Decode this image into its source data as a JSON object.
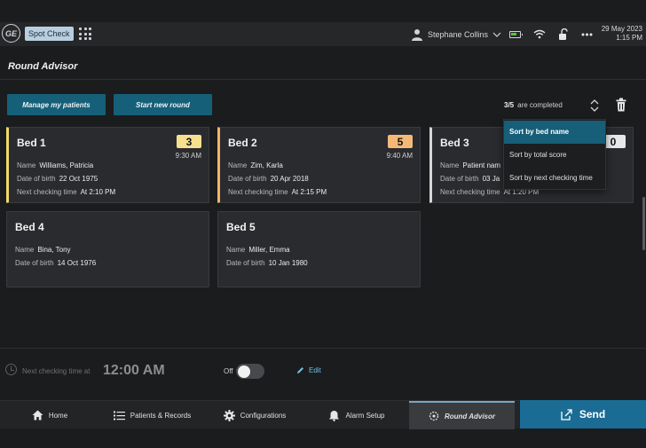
{
  "topbar": {
    "logo_text": "GE",
    "mode_label": "Spot Check",
    "user_name": "Stephane Collins",
    "date": "29 May 2023",
    "time": "1:15 PM"
  },
  "page": {
    "title": "Round Advisor"
  },
  "toolbar": {
    "manage_label": "Manage my patients",
    "start_label": "Start new round",
    "completed_count": "3/5",
    "completed_text": "are completed"
  },
  "sort_menu": {
    "items": [
      "Sort by bed name",
      "Sort by total score",
      "Sort by next checking time"
    ],
    "selected": "Sort by bed name"
  },
  "labels": {
    "name": "Name",
    "dob": "Date of birth",
    "next": "Next checking time"
  },
  "beds": [
    {
      "bed": "Bed 1",
      "score": "3",
      "time": "9:30 AM",
      "name": "Williams, Patricia",
      "dob": "22 Oct 1975",
      "next": "At 2:10 PM"
    },
    {
      "bed": "Bed 2",
      "score": "5",
      "time": "9:40 AM",
      "name": "Zim, Karla",
      "dob": "20 Apr 2018",
      "next": "At 2:15 PM"
    },
    {
      "bed": "Bed 3",
      "score": "0",
      "time": "",
      "name": "Patient nam",
      "dob": "03 Ja",
      "next": "At 1:20 PM"
    },
    {
      "bed": "Bed 4",
      "name": "Bina, Tony",
      "dob": "14 Oct 1976"
    },
    {
      "bed": "Bed 5",
      "name": "Miller, Emma",
      "dob": "10 Jan 1980"
    }
  ],
  "footer": {
    "next_label": "Next checking time at",
    "next_value": "12:00 AM",
    "toggle_label": "Off",
    "toggle_state": "off",
    "edit_label": "Edit"
  },
  "nav": {
    "home": "Home",
    "patients": "Patients & Records",
    "config": "Configurations",
    "alarm": "Alarm Setup",
    "round": "Round Advisor",
    "send": "Send"
  },
  "colors": {
    "accent": "#165f78",
    "send": "#1a6c95",
    "score_low": "#f6e08f",
    "score_mid": "#f5b977",
    "score_zero": "#e7e8ea",
    "battery": "#57c23e",
    "link": "#6ac3e0"
  },
  "icons": [
    "ge-logo",
    "apps-grid-icon",
    "user-icon",
    "chevron-down-icon",
    "battery-icon",
    "wifi-icon",
    "unlock-icon",
    "more-icon",
    "sort-icon",
    "trash-icon",
    "clock-icon",
    "pencil-icon",
    "home-icon",
    "list-icon",
    "gear-icon",
    "alarm-icon",
    "round-advisor-icon",
    "send-icon"
  ]
}
